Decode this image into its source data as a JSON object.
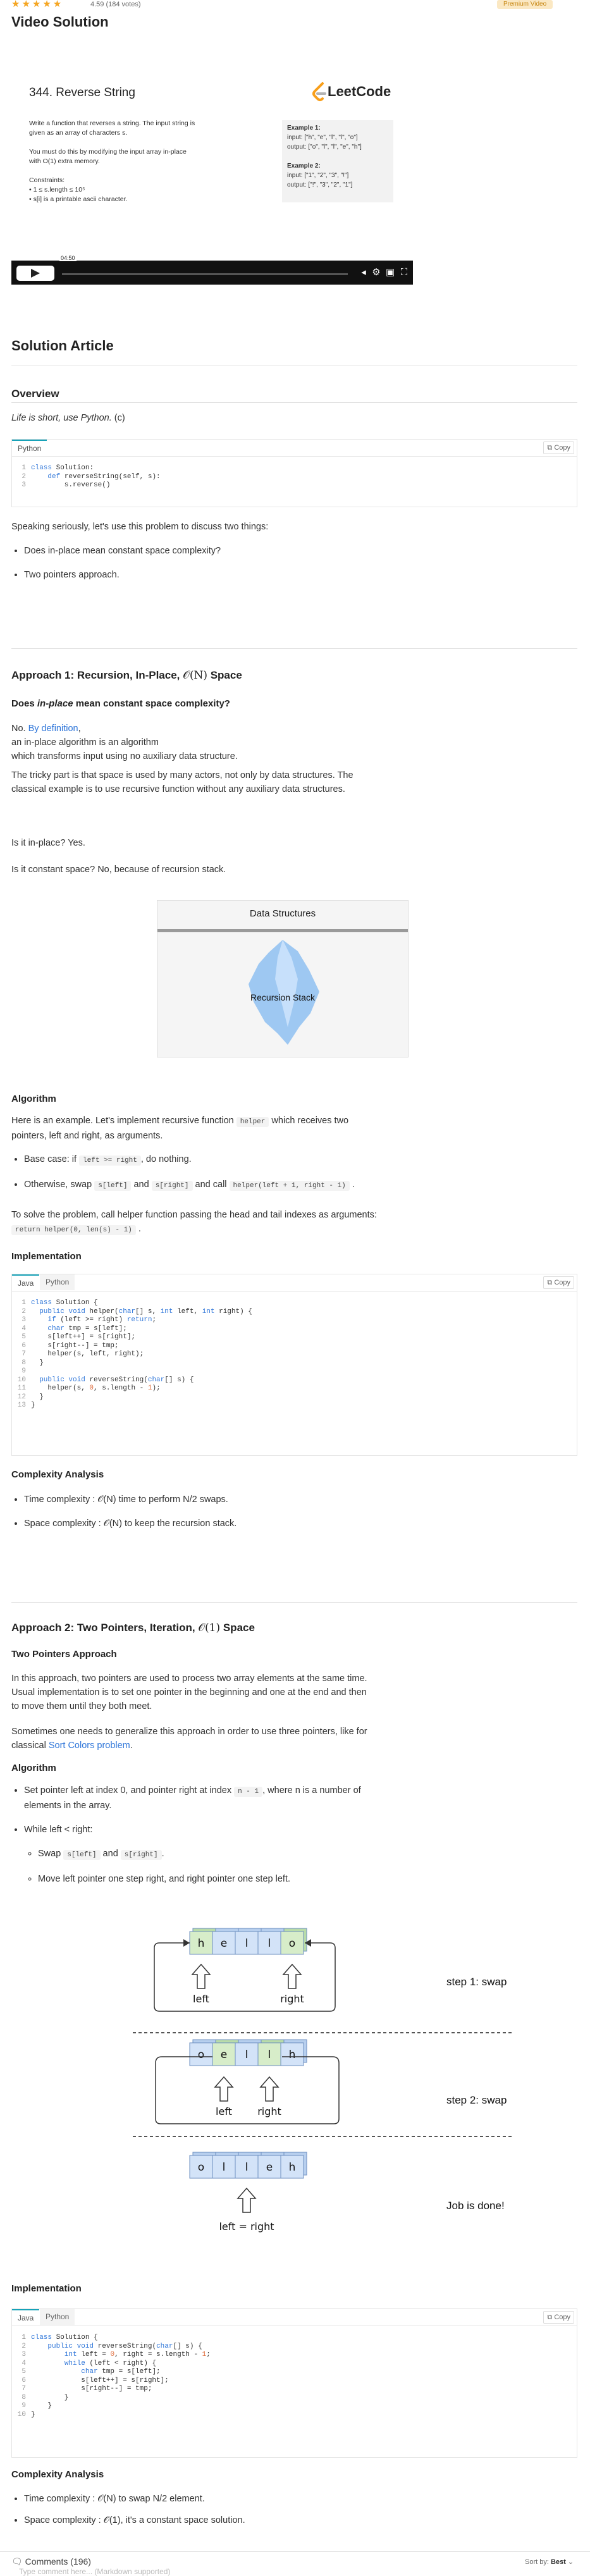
{
  "rating": {
    "stars": "★★★★★",
    "text": "4.59 (184 votes)"
  },
  "premium_badge": "Premium Video",
  "video_section": {
    "title": "Video Solution",
    "problem_title": "344. Reverse String",
    "logo_text": "LeetCode",
    "desc_lines": [
      "Write a function that reverses a string. The input string is",
      "given as an array of characters s.",
      "",
      "You must do this by modifying the input array in-place",
      "with O(1) extra memory.",
      "",
      "Constraints:",
      "• 1 ≤ s.length ≤ 10⁵",
      "• s[i] is a printable ascii character."
    ],
    "example_lines": [
      "Example 1:",
      "input: [\"h\", \"e\", \"l\", \"l\", \"o\"]",
      "output: [\"o\", \"l\", \"l\", \"e\", \"h\"]",
      "",
      "Example 2:",
      "input: [\"1\", \"2\", \"3\", \"!\"]",
      "output: [\"!\", \"3\", \"2\", \"1\"]"
    ],
    "time": "04:50",
    "play_label": "play"
  },
  "article": {
    "title": "Solution Article",
    "overview": {
      "heading": "Overview",
      "intro_italic": "Life is short, use Python.",
      "intro_suffix": " (c)",
      "speaking": "Speaking seriously, let's use this problem to discuss two things:",
      "bullets": [
        "Does in-place mean constant space complexity?",
        "Two pointers approach."
      ],
      "code": {
        "tab": "Python",
        "copy": "Copy",
        "lines": [
          {
            "n": "1",
            "t": "class Solution:"
          },
          {
            "n": "2",
            "t": "    def reverseString(self, s):"
          },
          {
            "n": "3",
            "t": "        s.reverse()"
          }
        ]
      }
    },
    "approach1": {
      "heading": "Approach 1: Recursion, In-Place, ",
      "heading_math": "𝒪(N)",
      "heading_suffix": " Space",
      "subheading": "Does in-place mean constant space complexity?",
      "no_text": "No. ",
      "definition_link": "By definition",
      "def_line1": "an in-place algorithm is an algorithm",
      "def_line2": "which transforms input using no auxiliary data structure.",
      "tricky": "The tricky part is that space is used by many actors, not only by data structures. The classical example is to use recursive function without any auxiliary data structures.",
      "q1": "Is it in-place? Yes.",
      "q2": "Is it constant space? No, because of recursion stack.",
      "figure": {
        "title": "Data Structures",
        "label": "Recursion Stack"
      },
      "algorithm_heading": "Algorithm",
      "algorithm_text_prefix": "Here is an example. Let's implement recursive function ",
      "algorithm_code": "helper",
      "algorithm_text_suffix": " which receives two pointers, left and right, as arguments.",
      "base_case_prefix": "Base case: if ",
      "base_case_code": "left >= right",
      "base_case_suffix": ", do nothing.",
      "otherwise_prefix": "Otherwise, swap ",
      "otherwise_code1": "s[left]",
      "otherwise_and": " and ",
      "otherwise_code2": "s[right]",
      "otherwise_call": " and call ",
      "otherwise_code3": "helper(left + 1, right - 1)",
      "otherwise_end": " .",
      "solve_prefix": "To solve the problem, call helper function passing the head and tail indexes as arguments: ",
      "solve_code": "return helper(0, len(s) - 1)",
      "solve_end": " .",
      "impl_heading": "Implementation",
      "code": {
        "tab_java": "Java",
        "tab_python": "Python",
        "copy": "Copy",
        "lines": [
          {
            "n": "1",
            "t": "class Solution {"
          },
          {
            "n": "2",
            "t": "  public void helper(char[] s, int left, int right) {"
          },
          {
            "n": "3",
            "t": "    if (left >= right) return;"
          },
          {
            "n": "4",
            "t": "    char tmp = s[left];"
          },
          {
            "n": "5",
            "t": "    s[left++] = s[right];"
          },
          {
            "n": "6",
            "t": "    s[right--] = tmp;"
          },
          {
            "n": "7",
            "t": "    helper(s, left, right);"
          },
          {
            "n": "8",
            "t": "  }"
          },
          {
            "n": "9",
            "t": ""
          },
          {
            "n": "10",
            "t": "  public void reverseString(char[] s) {"
          },
          {
            "n": "11",
            "t": "    helper(s, 0, s.length - 1);"
          },
          {
            "n": "12",
            "t": "  }"
          },
          {
            "n": "13",
            "t": "}"
          }
        ]
      },
      "complexity_heading": "Complexity Analysis",
      "time_complexity": "Time complexity : 𝒪(N) time to perform N/2 swaps.",
      "space_complexity": "Space complexity : 𝒪(N) to keep the recursion stack."
    },
    "approach2": {
      "heading": "Approach 2: Two Pointers, Iteration, ",
      "heading_math": "𝒪(1)",
      "heading_suffix": " Space",
      "subheading": "Two Pointers Approach",
      "para1": "In this approach, two pointers are used to process two array elements at the same time. Usual implementation is to set one pointer in the beginning and one at the end and then to move them until they both meet.",
      "para2_prefix": "Sometimes one needs to generalize this approach in order to use three pointers, like for classical ",
      "para2_link": "Sort Colors problem",
      "para2_suffix": ".",
      "algorithm_heading": "Algorithm",
      "bullet1_prefix": "Set pointer left at index 0, and pointer right at index ",
      "bullet1_code": "n - 1",
      "bullet1_suffix": ", where n is a number of elements in the array.",
      "bullet2": "While left < right:",
      "sub1_prefix": "Swap ",
      "sub1_code1": "s[left]",
      "sub1_and": " and ",
      "sub1_code2": "s[right]",
      "sub1_end": ".",
      "sub2": "Move left pointer one step right, and right pointer one step left.",
      "figure": {
        "step1_letters": [
          "h",
          "e",
          "l",
          "l",
          "o"
        ],
        "step2_letters": [
          "o",
          "e",
          "l",
          "l",
          "h"
        ],
        "step3_letters": [
          "o",
          "l",
          "l",
          "e",
          "h"
        ],
        "left": "left",
        "right": "right",
        "step1_label": "step 1: swap",
        "step2_label": "step 2: swap",
        "done_label": "Job is done!",
        "equal_label": "left = right"
      },
      "impl_heading": "Implementation",
      "code": {
        "tab_java": "Java",
        "tab_python": "Python",
        "copy": "Copy",
        "lines": [
          {
            "n": "1",
            "t": "class Solution {"
          },
          {
            "n": "2",
            "t": "    public void reverseString(char[] s) {"
          },
          {
            "n": "3",
            "t": "        int left = 0, right = s.length - 1;"
          },
          {
            "n": "4",
            "t": "        while (left < right) {"
          },
          {
            "n": "5",
            "t": "            char tmp = s[left];"
          },
          {
            "n": "6",
            "t": "            s[left++] = s[right];"
          },
          {
            "n": "7",
            "t": "            s[right--] = tmp;"
          },
          {
            "n": "8",
            "t": "        }"
          },
          {
            "n": "9",
            "t": "    }"
          },
          {
            "n": "10",
            "t": "}"
          }
        ]
      },
      "complexity_heading": "Complexity Analysis",
      "time_complexity": "Time complexity : 𝒪(N) to swap N/2 element.",
      "space_complexity": "Space complexity : 𝒪(1), it's a constant space solution."
    }
  },
  "comments": {
    "label": "Comments (196)",
    "sort_label": "Sort by:",
    "sort_value": "Best",
    "placeholder": "Type comment here... (Markdown supported)"
  },
  "colors": {
    "accent": "#17a2b8",
    "link": "#2f76d9",
    "star": "#f5a623"
  }
}
